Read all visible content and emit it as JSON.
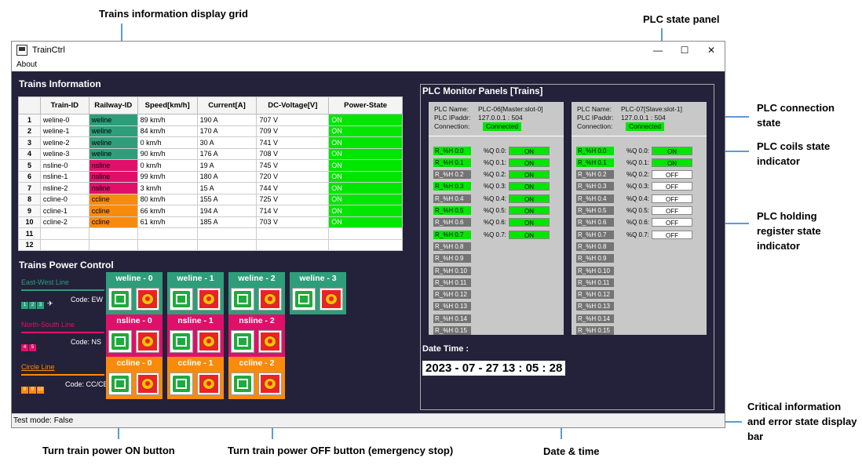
{
  "annotations": {
    "grid": "Trains information display grid",
    "plc_panel": "PLC state panel",
    "plc_connection": "PLC connection state",
    "plc_coils": "PLC coils state indicator",
    "plc_holding": "PLC holding register state indicator",
    "error_bar": "Critical information and error state display bar",
    "power_on": "Turn train power ON button",
    "power_off": "Turn train power OFF button (emergency stop)",
    "datetime": "Date & time"
  },
  "window": {
    "title": "TrainCtrl",
    "menu": "About",
    "minimize": "—",
    "maximize": "☐",
    "close": "✕"
  },
  "trains_info": {
    "title": "Trains Information",
    "columns": [
      "",
      "Train-ID",
      "Railway-ID",
      "Speed[km/h]",
      "Current[A]",
      "DC-Voltage[V]",
      "Power-State"
    ],
    "rows": [
      [
        "1",
        "weline-0",
        "weline",
        "89 km/h",
        "190 A",
        "707 V",
        "ON"
      ],
      [
        "2",
        "weline-1",
        "weline",
        "84 km/h",
        "170 A",
        "709 V",
        "ON"
      ],
      [
        "3",
        "weline-2",
        "weline",
        "0 km/h",
        "30 A",
        "741 V",
        "ON"
      ],
      [
        "4",
        "weline-3",
        "weline",
        "90 km/h",
        "176 A",
        "708 V",
        "ON"
      ],
      [
        "5",
        "nsline-0",
        "nsline",
        "0 km/h",
        "19 A",
        "745 V",
        "ON"
      ],
      [
        "6",
        "nsline-1",
        "nsline",
        "99 km/h",
        "180 A",
        "720 V",
        "ON"
      ],
      [
        "7",
        "nsline-2",
        "nsline",
        "3 km/h",
        "15 A",
        "744 V",
        "ON"
      ],
      [
        "8",
        "ccline-0",
        "ccline",
        "80 km/h",
        "155 A",
        "725 V",
        "ON"
      ],
      [
        "9",
        "ccline-1",
        "ccline",
        "66 km/h",
        "194 A",
        "714 V",
        "ON"
      ],
      [
        "10",
        "ccline-2",
        "ccline",
        "61 km/h",
        "185 A",
        "703 V",
        "ON"
      ],
      [
        "11",
        "",
        "",
        "",
        "",
        "",
        ""
      ],
      [
        "12",
        "",
        "",
        "",
        "",
        "",
        ""
      ]
    ]
  },
  "power_control": {
    "title": "Trains Power Control",
    "lines": [
      {
        "name": "East-West Line",
        "code": "Code: EW",
        "color": "#2e9e7a",
        "tags": [
          "1",
          "2",
          "3"
        ],
        "trains": [
          "weline - 0",
          "weline - 1",
          "weline - 2",
          "weline - 3"
        ]
      },
      {
        "name": "North-South Line",
        "code": "Code: NS",
        "color": "#e0106a",
        "tags": [
          "4",
          "5"
        ],
        "trains": [
          "nsline - 0",
          "nsline - 1",
          "nsline - 2"
        ]
      },
      {
        "name": "Circle Line",
        "code": "Code: CC/CE",
        "color": "#f98b0c",
        "tags": [
          "8",
          "9",
          "10"
        ],
        "trains": [
          "ccline - 0",
          "ccline - 1",
          "ccline - 2"
        ]
      }
    ]
  },
  "plc": {
    "title": "PLC Monitor Panels [Trains]",
    "panels": [
      {
        "name_label": "PLC Name:",
        "name": "PLC-06[Master:slot-0]",
        "ip_label": "PLC IPaddr:",
        "ip": "127.0.0.1 : 504",
        "conn_label": "Connection:",
        "conn": "Connected",
        "registers": [
          "R_%H 0.0",
          "R_%H 0.1",
          "R_%H 0.2",
          "R_%H 0.3",
          "R_%H 0.4",
          "R_%H 0.5",
          "R_%H 0.6",
          "R_%H 0.7",
          "R_%H 0.8",
          "R_%H 0.9",
          "R_%H 0.10",
          "R_%H 0.11",
          "R_%H 0.12",
          "R_%H 0.13",
          "R_%H 0.14",
          "R_%H 0.15"
        ],
        "register_states": [
          "on",
          "on",
          "off",
          "on",
          "off",
          "on",
          "off",
          "on",
          "off",
          "off",
          "off",
          "off",
          "off",
          "off",
          "off",
          "off"
        ],
        "coils": [
          "%Q 0.0:",
          "%Q 0.1:",
          "%Q 0.2:",
          "%Q 0.3:",
          "%Q 0.4:",
          "%Q 0.5:",
          "%Q 0.6:",
          "%Q 0.7:"
        ],
        "coil_values": [
          "ON",
          "ON",
          "ON",
          "ON",
          "ON",
          "ON",
          "ON",
          "ON"
        ]
      },
      {
        "name_label": "PLC Name:",
        "name": "PLC-07[Slave:slot-1]",
        "ip_label": "PLC IPaddr:",
        "ip": "127.0.0.1 : 504",
        "conn_label": "Connection:",
        "conn": "Connected",
        "registers": [
          "R_%H 0.0",
          "R_%H 0.1",
          "R_%H 0.2",
          "R_%H 0.3",
          "R_%H 0.4",
          "R_%H 0.5",
          "R_%H 0.6",
          "R_%H 0.7",
          "R_%H 0.8",
          "R_%H 0.9",
          "R_%H 0.10",
          "R_%H 0.11",
          "R_%H 0.12",
          "R_%H 0.13",
          "R_%H 0.14",
          "R_%H 0.15"
        ],
        "register_states": [
          "on",
          "on",
          "off",
          "off",
          "off",
          "off",
          "off",
          "off",
          "off",
          "off",
          "off",
          "off",
          "off",
          "off",
          "off",
          "off"
        ],
        "coils": [
          "%Q 0.0:",
          "%Q 0.1:",
          "%Q 0.2:",
          "%Q 0.3:",
          "%Q 0.4:",
          "%Q 0.5:",
          "%Q 0.6:",
          "%Q 0.7:"
        ],
        "coil_values": [
          "ON",
          "ON",
          "OFF",
          "OFF",
          "OFF",
          "OFF",
          "OFF",
          "OFF"
        ]
      }
    ]
  },
  "datetime": {
    "label": "Date  Time :",
    "value": "2023 - 07 - 27 13 : 05 : 28"
  },
  "status": "Test mode: False",
  "colors": {
    "on_green": "#00e600",
    "weline": "#2e9e7a",
    "nsline": "#e0106a",
    "ccline": "#f98b0c",
    "bg": "#23223a"
  }
}
